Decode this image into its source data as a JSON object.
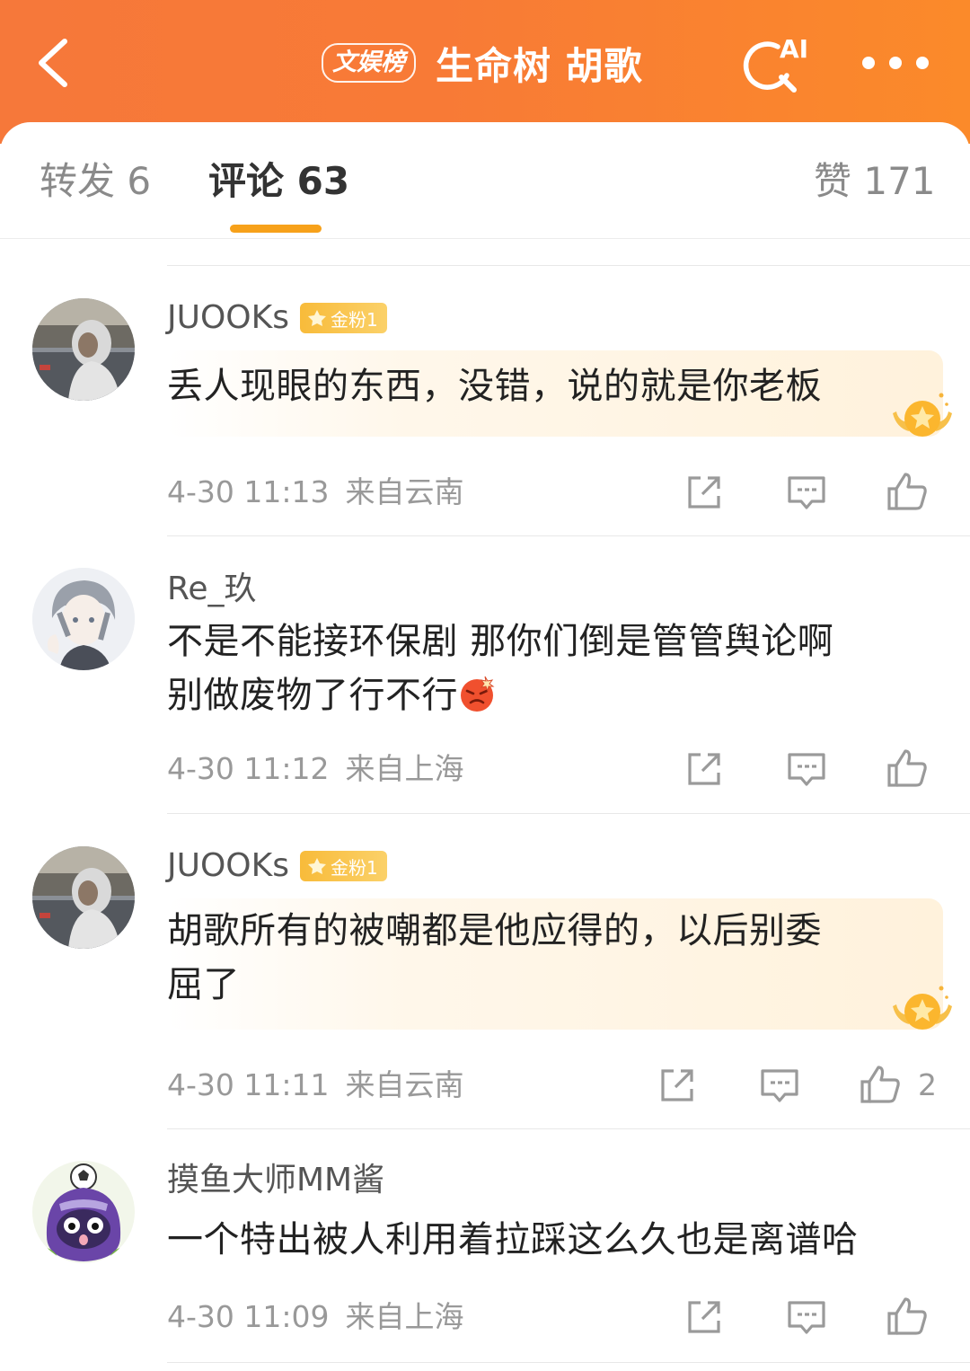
{
  "header": {
    "back_label": "返回",
    "tag": "文娱榜",
    "title": "生命树 胡歌",
    "ai_badge": "AI"
  },
  "tabs": {
    "repost": "转发 6",
    "comment": "评论 63",
    "like": "赞 171"
  },
  "comments": [
    {
      "username": "JUOOKs",
      "badge": "金粉1",
      "text": "丢人现眼的东西，没错，说的就是你老板",
      "time": "4-30 11:13",
      "location": "来自云南",
      "likes": ""
    },
    {
      "username": "Re_玖",
      "badge": "",
      "text_line1": "不是不能接环保剧 那你们倒是管管舆论啊",
      "text_line2": "别做废物了行不行",
      "time": "4-30 11:12",
      "location": "来自上海",
      "likes": ""
    },
    {
      "username": "JUOOKs",
      "badge": "金粉1",
      "text_line1": "胡歌所有的被嘲都是他应得的，以后别委",
      "text_line2": "屈了",
      "time": "4-30 11:11",
      "location": "来自云南",
      "likes": "2"
    },
    {
      "username": "摸鱼大师MM酱",
      "badge": "",
      "text": "一个特出被人利用着拉踩这么久也是离谱哈",
      "time": "4-30 11:09",
      "location": "来自上海",
      "likes": ""
    }
  ],
  "colors": {
    "header_start": "#f6783a",
    "header_end": "#fb8a2a",
    "tab_indicator": "#f7a11a",
    "badge_gold": "#f8bb3a"
  },
  "icons": [
    "back-arrow-icon",
    "ai-search-icon",
    "more-icon",
    "share-icon",
    "comment-icon",
    "like-icon",
    "medal-icon",
    "angry-emoji-icon",
    "crown-icon"
  ]
}
